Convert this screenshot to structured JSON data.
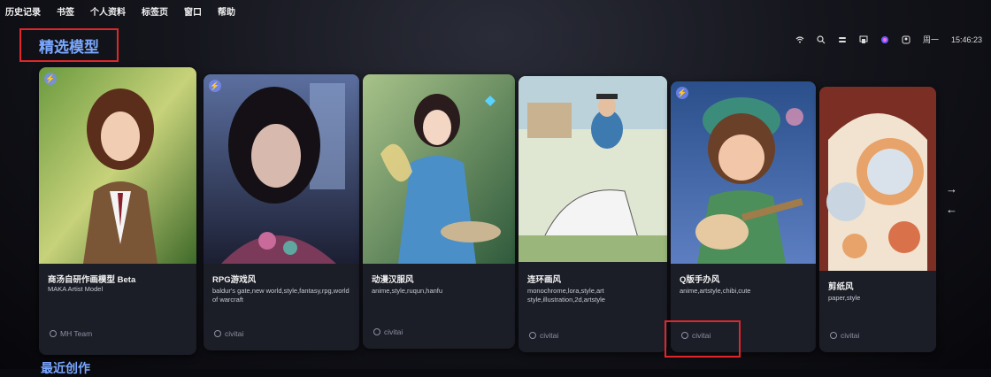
{
  "menubar": {
    "items": [
      "历史记录",
      "书签",
      "个人资料",
      "标签页",
      "窗口",
      "帮助"
    ]
  },
  "status": {
    "weekday": "周一",
    "time": "15:46:23"
  },
  "section": {
    "title": "精选模型",
    "accent": "#7aa8ff",
    "highlight_color": "#e0262a"
  },
  "cards": [
    {
      "title": "商汤自研作画模型 Beta",
      "subtitle": "MAKA Artist Model",
      "tags": "",
      "author": "MH Team",
      "badge": true
    },
    {
      "title": "RPG游戏风",
      "subtitle": "",
      "tags": "baldur's gate,new world,style,fantasy,rpg,world of warcraft",
      "author": "civitai",
      "badge": true
    },
    {
      "title": "动漫汉服风",
      "subtitle": "",
      "tags": "anime,style,ruqun,hanfu",
      "author": "civitai",
      "badge": false
    },
    {
      "title": "连环画风",
      "subtitle": "",
      "tags": "monochrome,lora,style,art style,illustration,2d,artstyle",
      "author": "civitai",
      "badge": false
    },
    {
      "title": "Q版手办风",
      "subtitle": "",
      "tags": "anime,artstyle,chibi,cute",
      "author": "civitai",
      "badge": true
    },
    {
      "title": "剪纸风",
      "subtitle": "",
      "tags": "paper,style",
      "author": "civitai",
      "badge": false
    }
  ],
  "nav": {
    "next": "→",
    "prev": "←"
  },
  "next_section": {
    "title": "最近创作"
  }
}
